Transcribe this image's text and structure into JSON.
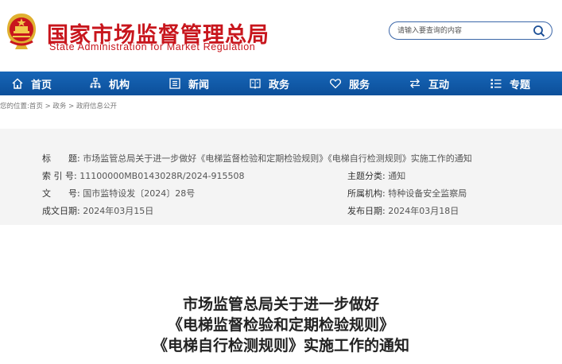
{
  "site": {
    "title_cn": "国家市场监督管理总局",
    "title_en": "State Administration for Market Regulation"
  },
  "search": {
    "placeholder": "请输入要查询的内容"
  },
  "nav": {
    "items": [
      {
        "label": "首页",
        "icon": "home-icon"
      },
      {
        "label": "机构",
        "icon": "org-icon"
      },
      {
        "label": "新闻",
        "icon": "news-icon"
      },
      {
        "label": "政务",
        "icon": "affairs-icon"
      },
      {
        "label": "服务",
        "icon": "heart-icon"
      },
      {
        "label": "互动",
        "icon": "exchange-icon"
      },
      {
        "label": "专题",
        "icon": "list-icon"
      }
    ]
  },
  "breadcrumb": {
    "prefix": "您的位置:",
    "home": "首页",
    "sep": " > ",
    "level1": "政务",
    "level2": "政府信息公开"
  },
  "info": {
    "title_label": "标　　题:",
    "title_value": "市场监管总局关于进一步做好《电梯监督检验和定期检验规则》《电梯自行检测规则》实施工作的通知",
    "index_label": "索 引 号:",
    "index_value": "11100000MB0143028R/2024-915508",
    "category_label": "主题分类:",
    "category_value": "通知",
    "doc_label": "文　　号:",
    "doc_value": "国市监特设发〔2024〕28号",
    "org_label": "所属机构:",
    "org_value": "特种设备安全监察局",
    "date_label": "成文日期:",
    "date_value": "2024年03月15日",
    "pub_label": "发布日期:",
    "pub_value": "2024年03月18日"
  },
  "article": {
    "title_line1": "市场监管总局关于进一步做好",
    "title_line2": "《电梯监督检验和定期检验规则》",
    "title_line3": "《电梯自行检测规则》实施工作的通知"
  },
  "colors": {
    "brand_red": "#c8161d",
    "nav_blue": "#0c4f9a"
  }
}
